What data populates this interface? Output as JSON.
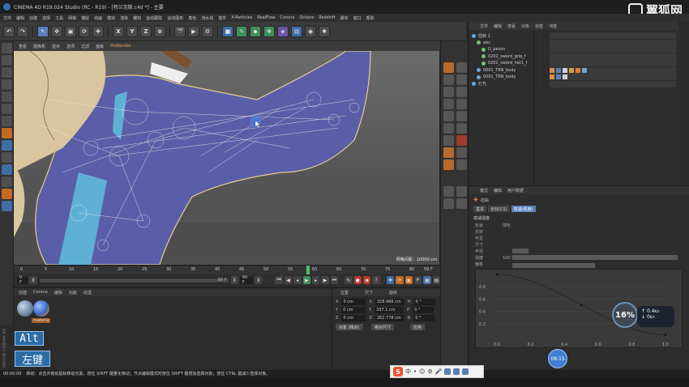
{
  "window": {
    "title": "CINEMA 4D R19.024 Studio (RC - R19) - [特兰克斯.c4d *] - 主要"
  },
  "watermark": {
    "text": "翼狐网"
  },
  "menu": [
    "文件",
    "编辑",
    "创建",
    "选择",
    "工具",
    "网格",
    "捕捉",
    "动画",
    "模拟",
    "渲染",
    "雕刻",
    "运动跟踪",
    "运动图形",
    "角色",
    "流水线",
    "插件",
    "X-Particles",
    "RealFlow",
    "Corona",
    "Octane",
    "Redshift",
    "脚本",
    "窗口",
    "帮助"
  ],
  "toolbar": {
    "axis_x": "X",
    "axis_y": "Y",
    "axis_z": "Z"
  },
  "viewport": {
    "menu": [
      "查看",
      "摄像机",
      "显示",
      "选项",
      "过滤",
      "面板"
    ],
    "prorender": "ProRender",
    "grid_hint": "网格间距：10000 cm"
  },
  "timeline": {
    "ticks": [
      "0",
      "5",
      "10",
      "15",
      "20",
      "25",
      "30",
      "35",
      "40",
      "45",
      "50",
      "55",
      "60",
      "65",
      "70",
      "75",
      "80"
    ],
    "current_frame": 59,
    "frame_field": "59 F"
  },
  "transport": {
    "start": "0 F",
    "end": "90 F",
    "end_field": "90 F"
  },
  "material_manager": {
    "tabs": [
      "创建",
      "Corona",
      "编辑",
      "功能",
      "纹理"
    ],
    "materials": [
      {
        "name": "",
        "color": "#6e86a3"
      },
      {
        "name": "materia",
        "color": "#c07a2a"
      }
    ]
  },
  "coordinates": {
    "headers": [
      "位置",
      "尺寸",
      "旋转"
    ],
    "rows": [
      {
        "axis": "X",
        "pos": "0 cm",
        "size": "328.466 cm",
        "rot_label": "H",
        "rot": "0 °"
      },
      {
        "axis": "Y",
        "pos": "0 cm",
        "size": "337.1 cm",
        "rot_label": "P",
        "rot": "0 °"
      },
      {
        "axis": "Z",
        "pos": "0 cm",
        "size": "262.778 cm",
        "rot_label": "B",
        "rot": "0 °"
      }
    ],
    "mode_object": "对象 (相对)",
    "mode_size": "绝对尺寸",
    "apply": "应用"
  },
  "object_manager": {
    "menu": [
      "文件",
      "编辑",
      "查看",
      "对象",
      "标签",
      "书签"
    ],
    "objects": [
      {
        "name": "扭转 1",
        "indent": 0,
        "color": "#6aa8d8"
      },
      {
        "name": "abc",
        "indent": 1,
        "color": "#6ec66e"
      },
      {
        "name": "G_pelvis",
        "indent": 2,
        "color": "#6ec66e"
      },
      {
        "name": "0202_sword_grip_f",
        "indent": 2,
        "color": "#6ec66e"
      },
      {
        "name": "0202_sword_hat1_f",
        "indent": 2,
        "color": "#6ec66e"
      },
      {
        "name": "0001_TRN_body",
        "indent": 1,
        "color": "#6aa8d8"
      },
      {
        "name": "0001_TRN_body",
        "indent": 1,
        "color": "#6aa8d8"
      },
      {
        "name": "灯光",
        "indent": 0,
        "color": "#6aa8d8"
      }
    ]
  },
  "attributes": {
    "menu": [
      "模式",
      "编辑",
      "用户数据"
    ],
    "object_type": "扭曲",
    "tabs": [
      "基本",
      "坐标(CS)",
      "衰减(强度)"
    ],
    "active_tab": "衰减(强度)",
    "section": "衰减强度",
    "rows": [
      {
        "label": "形状",
        "value": "球形"
      },
      {
        "label": "反转",
        "value": ""
      },
      {
        "label": "可见",
        "value": ""
      },
      {
        "label": "尺寸",
        "value": ""
      },
      {
        "label": "半径",
        "value": ""
      },
      {
        "label": "强度",
        "value": "100 %"
      },
      {
        "label": "偏移",
        "value": ""
      }
    ],
    "graph_y_ticks": [
      "0.8",
      "0.6",
      "0.4",
      "0.2"
    ],
    "graph_x_ticks": [
      "0.0",
      "0.2",
      "0.4",
      "0.6",
      "0.8",
      "1.0"
    ]
  },
  "overlays": {
    "badge": "16%",
    "speed_up": "0.4",
    "speed_down": "0",
    "speed_unit": "K/s",
    "timer": "08:15",
    "alt": "Alt",
    "key": "左键"
  },
  "status": {
    "time": "00:00:00",
    "text": "移动：点击并拖动鼠标移动元素。按住 SHIFT 键量化移动；节点编辑模式时按住 SHIFT 键增加选择对象；按住 CTRL 键减少选择对象。"
  },
  "ime": {
    "text": "中"
  },
  "branding": {
    "maxon": "MAXON CINEMA 4D"
  }
}
